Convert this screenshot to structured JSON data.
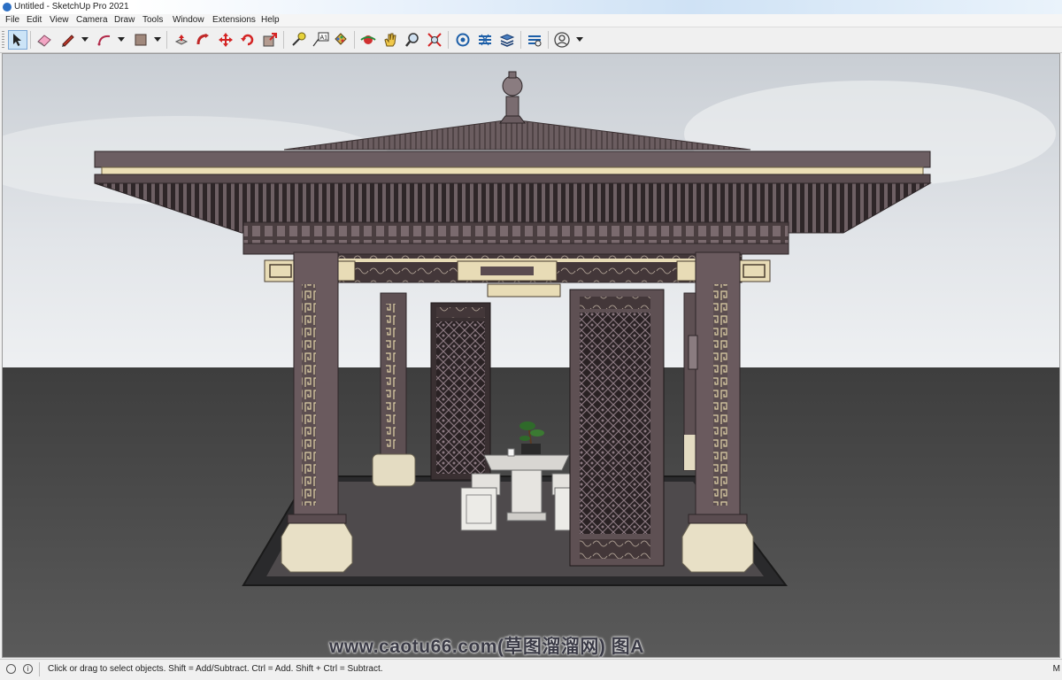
{
  "window": {
    "title": "Untitled - SketchUp Pro 2021"
  },
  "menu": {
    "items": [
      "File",
      "Edit",
      "View",
      "Camera",
      "Draw",
      "Tools",
      "Window",
      "Extensions",
      "Help"
    ]
  },
  "toolbar": {
    "tools": [
      {
        "name": "select-tool",
        "icon": "arrow-cursor-icon",
        "active": true
      },
      {
        "name": "eraser-tool",
        "icon": "eraser-icon"
      },
      {
        "name": "line-tool",
        "icon": "pencil-icon"
      },
      {
        "name": "arc-tool",
        "icon": "arc-icon"
      },
      {
        "name": "shape-tool",
        "icon": "rectangle-icon"
      },
      {
        "name": "push-pull-tool",
        "icon": "push-pull-icon"
      },
      {
        "name": "follow-me-tool",
        "icon": "follow-me-icon"
      },
      {
        "name": "move-tool",
        "icon": "move-arrows-icon"
      },
      {
        "name": "rotate-tool",
        "icon": "rotate-icon"
      },
      {
        "name": "scale-tool",
        "icon": "scale-icon"
      },
      {
        "name": "tape-measure-tool",
        "icon": "tape-measure-icon"
      },
      {
        "name": "text-tool",
        "icon": "text-label-icon"
      },
      {
        "name": "paint-bucket-tool",
        "icon": "paint-bucket-icon"
      },
      {
        "name": "orbit-tool",
        "icon": "orbit-icon"
      },
      {
        "name": "pan-tool",
        "icon": "hand-icon"
      },
      {
        "name": "zoom-tool",
        "icon": "magnifier-icon"
      },
      {
        "name": "zoom-extents-tool",
        "icon": "zoom-extents-icon"
      },
      {
        "name": "warehouse-button",
        "icon": "3d-warehouse-icon"
      },
      {
        "name": "extension-warehouse-button",
        "icon": "extension-warehouse-icon"
      },
      {
        "name": "layout-button",
        "icon": "layout-stack-icon"
      },
      {
        "name": "extension-manager-button",
        "icon": "extension-manager-icon"
      },
      {
        "name": "account-button",
        "icon": "user-account-icon"
      }
    ],
    "text_tool_glyph": "A1"
  },
  "viewport": {
    "sky_color": "#dfe2e6",
    "ground_color": "#4d4d4d",
    "model_color": "#6a5a5c",
    "trim_color": "#e8dcb6"
  },
  "watermark": {
    "text": "www.caotu66.com(草图溜溜网) 图A"
  },
  "statusbar": {
    "hint": "Click or drag to select objects. Shift = Add/Subtract. Ctrl = Add. Shift + Ctrl = Subtract.",
    "right_label": "M"
  }
}
